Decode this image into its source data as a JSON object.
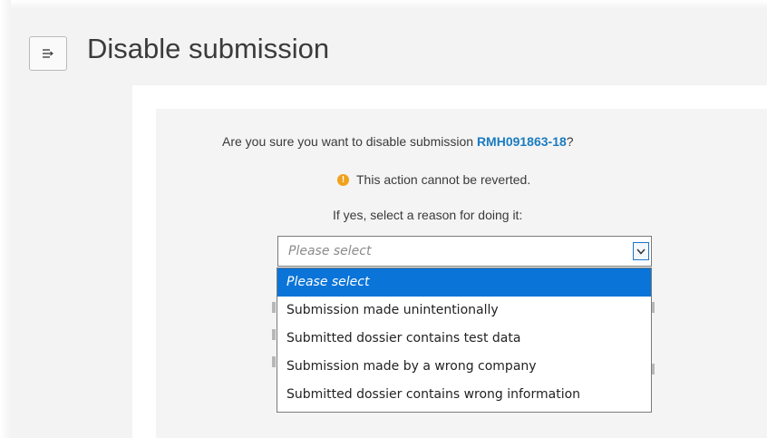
{
  "header": {
    "title": "Disable submission",
    "menu_icon": "menu-collapse-icon"
  },
  "dialog": {
    "question_prefix": "Are you sure you want to disable submission ",
    "submission_id": "RMH091863-18",
    "question_suffix": "?",
    "warning": "This action cannot be reverted.",
    "warning_icon": "warning-icon",
    "reason_prompt": "If yes, select a reason for doing it:"
  },
  "reason_select": {
    "value": "Please select",
    "options": [
      "Please select",
      "Submission made unintentionally",
      "Submitted dossier contains test data",
      "Submission made by a wrong company",
      "Submitted dossier contains wrong information"
    ]
  },
  "colors": {
    "link": "#1a7bc0",
    "warning": "#f0a21c",
    "selected_option": "#0a74d8"
  }
}
